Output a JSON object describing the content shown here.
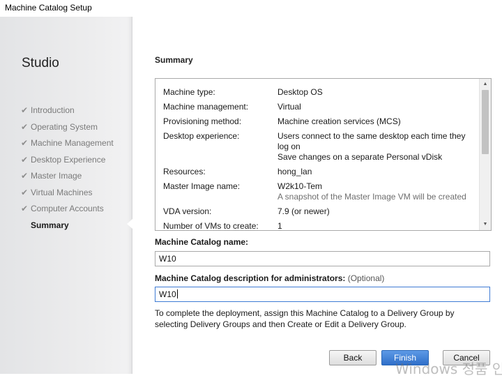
{
  "window": {
    "title": "Machine Catalog Setup"
  },
  "sidebar": {
    "brand": "Studio",
    "items": [
      {
        "label": "Introduction",
        "state": "done"
      },
      {
        "label": "Operating System",
        "state": "done"
      },
      {
        "label": "Machine Management",
        "state": "done"
      },
      {
        "label": "Desktop Experience",
        "state": "done"
      },
      {
        "label": "Master Image",
        "state": "done"
      },
      {
        "label": "Virtual Machines",
        "state": "done"
      },
      {
        "label": "Computer Accounts",
        "state": "done"
      },
      {
        "label": "Summary",
        "state": "current"
      }
    ],
    "check_glyph": "✔"
  },
  "main": {
    "heading": "Summary",
    "summary": [
      {
        "key": "Machine type:",
        "value": "Desktop OS"
      },
      {
        "key": "Machine management:",
        "value": "Virtual"
      },
      {
        "key": "Provisioning method:",
        "value": "Machine creation services (MCS)"
      },
      {
        "key": "Desktop experience:",
        "value": "Users connect to the same desktop each time they log on",
        "value2": "Save changes on a separate Personal vDisk"
      },
      {
        "key": "Resources:",
        "value": "hong_lan"
      },
      {
        "key": "Master Image name:",
        "value": "W2k10-Tem",
        "note": "A snapshot of the Master Image VM will be created"
      },
      {
        "key": "VDA version:",
        "value": "7.9 (or newer)"
      },
      {
        "key": "Number of VMs to create:",
        "value": "1"
      }
    ],
    "catalog_name_label": "Machine Catalog name:",
    "catalog_name_value": "W10",
    "description_label": "Machine Catalog description for administrators:",
    "description_optional": "(Optional)",
    "description_value": "W10",
    "info_text": "To complete the deployment, assign this Machine Catalog to a Delivery Group by selecting Delivery Groups and then Create or Edit a Delivery Group."
  },
  "buttons": {
    "back": "Back",
    "finish": "Finish",
    "cancel": "Cancel"
  },
  "watermark": "Windows 정품 인증",
  "colors": {
    "accent": "#2f6fc9",
    "sidebar_bg": "#e8e8ea",
    "focus_border": "#3e7bd4"
  }
}
